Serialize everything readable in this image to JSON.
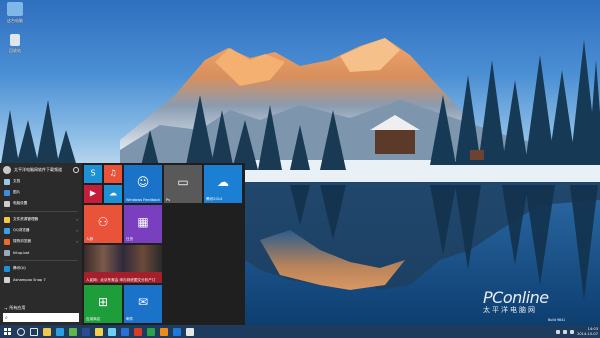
{
  "desktop": {
    "icons": [
      {
        "label": "这台电脑",
        "icon": "computer-icon",
        "color": "#7fb8e8"
      },
      {
        "label": "回收站",
        "icon": "recycle-bin-icon",
        "color": "#dfe6ee"
      }
    ]
  },
  "start_menu": {
    "user_name": "太平洋电脑网软件下载频道",
    "left_items": [
      {
        "label": "文档",
        "icon": "document-icon",
        "color": "#9fc6e8",
        "arrow": false
      },
      {
        "label": "图片",
        "icon": "pictures-icon",
        "color": "#3b8ee0",
        "arrow": false
      },
      {
        "label": "电脑设置",
        "icon": "settings-icon",
        "color": "#cccccc",
        "arrow": false
      },
      {
        "label": "文件资源管理器",
        "icon": "folder-icon",
        "color": "#f2c84b",
        "arrow": true
      },
      {
        "label": "QQ浏览器",
        "icon": "browser-icon",
        "color": "#3aa0ea",
        "arrow": true
      },
      {
        "label": "搜狗浏览器",
        "icon": "browser-icon",
        "color": "#ea6b2b",
        "arrow": true
      },
      {
        "label": "hitup.bat",
        "icon": "file-icon",
        "color": "#9aa7b5",
        "arrow": false
      },
      {
        "label": "腾讯QQ",
        "icon": "qq-icon",
        "color": "#1d8ee0",
        "arrow": false
      },
      {
        "label": "Ashampoo Snap 7",
        "icon": "snap-icon",
        "color": "#cfd3d8",
        "arrow": false
      }
    ],
    "all_apps_label": "所有应用",
    "search_placeholder": "",
    "tiles": [
      {
        "label": "",
        "icon": "skype-icon",
        "color": "#1e90d6",
        "glyph": "S"
      },
      {
        "label": "",
        "icon": "music-icon",
        "color": "#e8533a",
        "glyph": "♫"
      },
      {
        "label": "Windows Feedback",
        "icon": "feedback-icon",
        "color": "#1a73c9",
        "glyph": "☺"
      },
      {
        "label": "Ps",
        "icon": "folder-icon",
        "color": "#595959",
        "glyph": "▭"
      },
      {
        "label": "腾讯2014",
        "icon": "cloud-icon",
        "color": "#1b7fd3",
        "glyph": "☁"
      },
      {
        "label": "",
        "icon": "video-icon",
        "color": "#c41e3a",
        "glyph": "▶"
      },
      {
        "label": "",
        "icon": "onedrive-icon",
        "color": "#1e90d6",
        "glyph": "☁"
      },
      {
        "label": "人脉",
        "icon": "people-icon",
        "color": "#e8533a",
        "glyph": "⚇"
      },
      {
        "label": "日历",
        "icon": "calendar-icon",
        "color": "#7a3fbf",
        "glyph": "▦"
      },
      {
        "label": "人民网：北京冬奥会 申办到底图文分析产订",
        "icon": "news-icon",
        "color": "#a31f2b",
        "glyph": ""
      },
      {
        "label": "应用商店",
        "icon": "store-icon",
        "color": "#1e9e3a",
        "glyph": "⊞"
      },
      {
        "label": "邮件",
        "icon": "mail-icon",
        "color": "#1a73c9",
        "glyph": "✉"
      }
    ]
  },
  "taskbar": {
    "apps": [
      {
        "icon": "search-icon",
        "color": "#e6e6e6"
      },
      {
        "icon": "task-view-icon",
        "color": "#e6e6e6"
      },
      {
        "icon": "explorer-icon",
        "color": "#f2c84b"
      },
      {
        "icon": "ie-icon",
        "color": "#2a9fe0"
      },
      {
        "icon": "chat-icon",
        "color": "#5fb54a"
      },
      {
        "icon": "photoshop-icon",
        "color": "#2b4d8f"
      },
      {
        "icon": "app-icon",
        "color": "#f2d24b"
      },
      {
        "icon": "app-icon",
        "color": "#6fcff0"
      },
      {
        "icon": "app-icon",
        "color": "#2b6fd6"
      },
      {
        "icon": "app-icon",
        "color": "#d93b2b"
      },
      {
        "icon": "app-icon",
        "color": "#29a34a"
      },
      {
        "icon": "app-icon",
        "color": "#ef8a1f"
      },
      {
        "icon": "app-icon",
        "color": "#1e7ad9"
      },
      {
        "icon": "app-icon",
        "color": "#e6e6e6"
      }
    ],
    "clock_time": "14:03",
    "clock_date": "2014-10-07"
  },
  "watermark": {
    "brand": "PConline",
    "sub": "太平洋电脑网"
  },
  "build_text": "Build 9841"
}
